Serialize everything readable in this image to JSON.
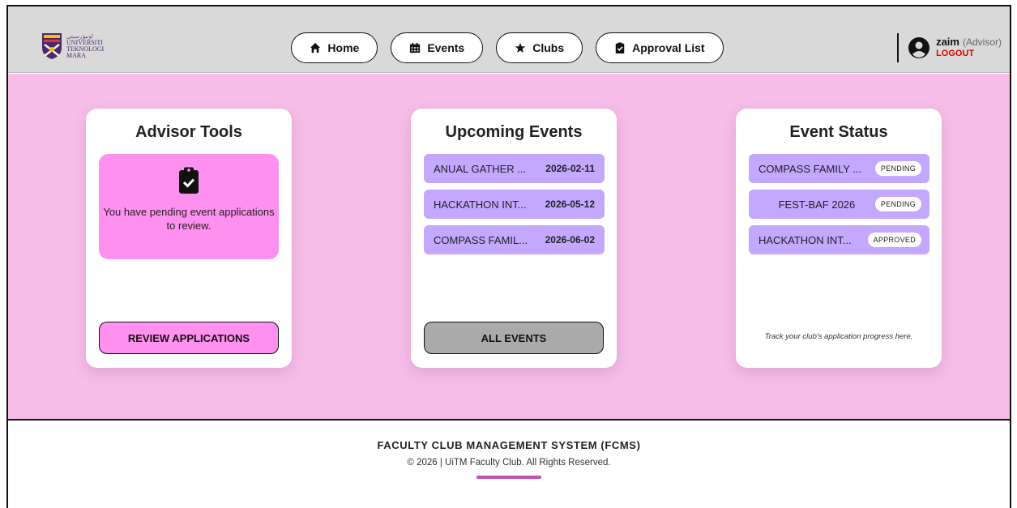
{
  "header": {
    "logo": {
      "jawi": "اونيۏرسيتي",
      "line1": "UNIVERSITI",
      "line2": "TEKNOLOGI",
      "line3": "MARA"
    },
    "nav": [
      {
        "label": "Home",
        "icon": "home-icon"
      },
      {
        "label": "Events",
        "icon": "calendar-icon"
      },
      {
        "label": "Clubs",
        "icon": "star-icon"
      },
      {
        "label": "Approval List",
        "icon": "clipboard-check-icon"
      }
    ],
    "user": {
      "name": "zaim",
      "role": "(Advisor)",
      "logout_label": "LOGOUT",
      "icon": "user-circle-icon"
    }
  },
  "advisor_tools": {
    "title": "Advisor Tools",
    "pending_message": "You have pending event applications to review.",
    "button_label": "REVIEW APPLICATIONS"
  },
  "upcoming_events": {
    "title": "Upcoming Events",
    "items": [
      {
        "name": "ANUAL GATHER ...",
        "date": "2026-02-11"
      },
      {
        "name": "HACKATHON INT...",
        "date": "2026-05-12"
      },
      {
        "name": "COMPASS FAMIL...",
        "date": "2026-06-02"
      }
    ],
    "button_label": "ALL EVENTS"
  },
  "event_status": {
    "title": "Event Status",
    "items": [
      {
        "name": "COMPASS FAMILY ...",
        "status": "PENDING"
      },
      {
        "name": "FEST-BAF 2026",
        "status": "PENDING"
      },
      {
        "name": "HACKATHON INT...",
        "status": "APPROVED"
      }
    ],
    "note": "Track your club's application progress here."
  },
  "footer": {
    "title": "FACULTY CLUB MANAGEMENT SYSTEM (FCMS)",
    "copyright": "© 2026 | UiTM Faculty Club. All Rights Reserved."
  },
  "colors": {
    "main_bg": "#f6bde8",
    "header_bg": "#d9d9d9",
    "accent_pink": "#ff90f0",
    "event_purple": "#c4a7ff",
    "logout_red": "#e00000",
    "footer_line": "#c44fb4"
  }
}
